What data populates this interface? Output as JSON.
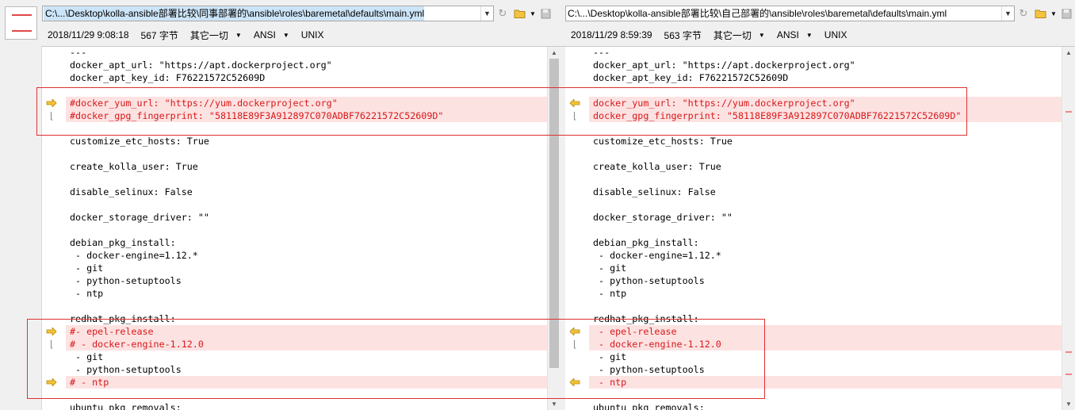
{
  "left": {
    "path": "C:\\...\\Desktop\\kolla-ansible部署比较\\同事部署的\\ansible\\roles\\baremetal\\defaults\\main.yml",
    "timestamp": "2018/11/29 9:08:18",
    "size": "567 字节",
    "format_label": "其它一切",
    "encoding": "ANSI",
    "line_ending": "UNIX"
  },
  "right": {
    "path": "C:\\...\\Desktop\\kolla-ansible部署比较\\自己部署的\\ansible\\roles\\baremetal\\defaults\\main.yml",
    "timestamp": "2018/11/29 8:59:39",
    "size": "563 字节",
    "format_label": "其它一切",
    "encoding": "ANSI",
    "line_ending": "UNIX"
  },
  "left_lines": [
    {
      "text": "---",
      "diff": false,
      "mark": ""
    },
    {
      "text": "docker_apt_url: \"https://apt.dockerproject.org\"",
      "diff": false,
      "mark": ""
    },
    {
      "text": "docker_apt_key_id: F76221572C52609D",
      "diff": false,
      "mark": ""
    },
    {
      "text": "",
      "diff": false,
      "mark": ""
    },
    {
      "text": "#docker_yum_url: \"https://yum.dockerproject.org\"",
      "diff": true,
      "mark": "arrow"
    },
    {
      "text": "#docker_gpg_fingerprint: \"58118E89F3A912897C070ADBF76221572C52609D\"",
      "diff": true,
      "mark": "cont"
    },
    {
      "text": "",
      "diff": false,
      "mark": ""
    },
    {
      "text": "customize_etc_hosts: True",
      "diff": false,
      "mark": ""
    },
    {
      "text": "",
      "diff": false,
      "mark": ""
    },
    {
      "text": "create_kolla_user: True",
      "diff": false,
      "mark": ""
    },
    {
      "text": "",
      "diff": false,
      "mark": ""
    },
    {
      "text": "disable_selinux: False",
      "diff": false,
      "mark": ""
    },
    {
      "text": "",
      "diff": false,
      "mark": ""
    },
    {
      "text": "docker_storage_driver: \"\"",
      "diff": false,
      "mark": ""
    },
    {
      "text": "",
      "diff": false,
      "mark": ""
    },
    {
      "text": "debian_pkg_install:",
      "diff": false,
      "mark": ""
    },
    {
      "text": " - docker-engine=1.12.*",
      "diff": false,
      "mark": ""
    },
    {
      "text": " - git",
      "diff": false,
      "mark": ""
    },
    {
      "text": " - python-setuptools",
      "diff": false,
      "mark": ""
    },
    {
      "text": " - ntp",
      "diff": false,
      "mark": ""
    },
    {
      "text": "",
      "diff": false,
      "mark": ""
    },
    {
      "text": "redhat_pkg_install:",
      "diff": false,
      "mark": ""
    },
    {
      "text": "#- epel-release",
      "diff": true,
      "mark": "arrow"
    },
    {
      "text": "# - docker-engine-1.12.0",
      "diff": true,
      "mark": "cont"
    },
    {
      "text": " - git",
      "diff": false,
      "mark": ""
    },
    {
      "text": " - python-setuptools",
      "diff": false,
      "mark": ""
    },
    {
      "text": "# - ntp",
      "diff": true,
      "mark": "arrow"
    },
    {
      "text": "",
      "diff": false,
      "mark": ""
    },
    {
      "text": "ubuntu_pkg_removals:",
      "diff": false,
      "mark": ""
    }
  ],
  "right_lines": [
    {
      "text": "---",
      "diff": false,
      "mark": ""
    },
    {
      "text": "docker_apt_url: \"https://apt.dockerproject.org\"",
      "diff": false,
      "mark": ""
    },
    {
      "text": "docker_apt_key_id: F76221572C52609D",
      "diff": false,
      "mark": ""
    },
    {
      "text": "",
      "diff": false,
      "mark": ""
    },
    {
      "text": "docker_yum_url: \"https://yum.dockerproject.org\"",
      "diff": true,
      "mark": "arrow"
    },
    {
      "text": "docker_gpg_fingerprint: \"58118E89F3A912897C070ADBF76221572C52609D\"",
      "diff": true,
      "mark": "cont"
    },
    {
      "text": "",
      "diff": false,
      "mark": ""
    },
    {
      "text": "customize_etc_hosts: True",
      "diff": false,
      "mark": ""
    },
    {
      "text": "",
      "diff": false,
      "mark": ""
    },
    {
      "text": "create_kolla_user: True",
      "diff": false,
      "mark": ""
    },
    {
      "text": "",
      "diff": false,
      "mark": ""
    },
    {
      "text": "disable_selinux: False",
      "diff": false,
      "mark": ""
    },
    {
      "text": "",
      "diff": false,
      "mark": ""
    },
    {
      "text": "docker_storage_driver: \"\"",
      "diff": false,
      "mark": ""
    },
    {
      "text": "",
      "diff": false,
      "mark": ""
    },
    {
      "text": "debian_pkg_install:",
      "diff": false,
      "mark": ""
    },
    {
      "text": " - docker-engine=1.12.*",
      "diff": false,
      "mark": ""
    },
    {
      "text": " - git",
      "diff": false,
      "mark": ""
    },
    {
      "text": " - python-setuptools",
      "diff": false,
      "mark": ""
    },
    {
      "text": " - ntp",
      "diff": false,
      "mark": ""
    },
    {
      "text": "",
      "diff": false,
      "mark": ""
    },
    {
      "text": "redhat_pkg_install:",
      "diff": false,
      "mark": ""
    },
    {
      "text": " - epel-release",
      "diff": true,
      "mark": "arrow"
    },
    {
      "text": " - docker-engine-1.12.0",
      "diff": true,
      "mark": "cont"
    },
    {
      "text": " - git",
      "diff": false,
      "mark": ""
    },
    {
      "text": " - python-setuptools",
      "diff": false,
      "mark": ""
    },
    {
      "text": " - ntp",
      "diff": true,
      "mark": "arrow"
    },
    {
      "text": "",
      "diff": false,
      "mark": ""
    },
    {
      "text": "ubuntu_pkg_removals:",
      "diff": false,
      "mark": ""
    }
  ],
  "icons": {
    "thumbnail": "diff-overview-icon",
    "reload": "reload-icon",
    "browse": "open-folder-icon",
    "save": "save-icon",
    "left_marker": "arrow-right-icon",
    "right_marker": "arrow-left-icon"
  },
  "colors": {
    "diff_background": "#fde2e2",
    "diff_text": "#d81818",
    "annotation_box": "#e03030",
    "marker": "#d9a300",
    "path_selection": "#cce4f7"
  }
}
